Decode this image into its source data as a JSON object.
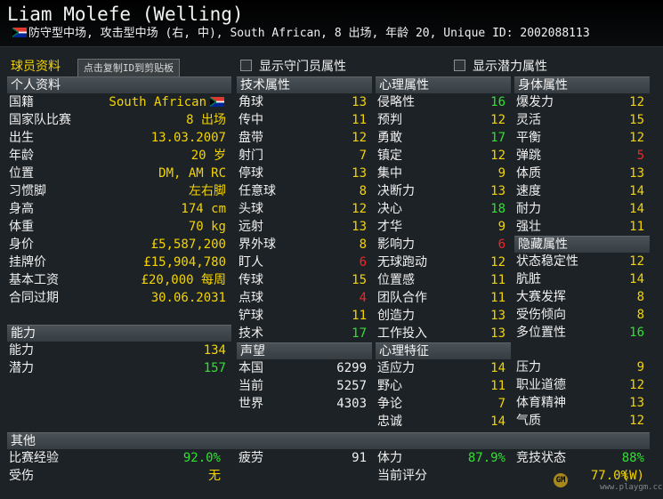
{
  "header": {
    "name": "Liam Molefe (Welling)",
    "subtitle": "防守型中场, 攻击型中场 (右, 中), South African, 8 出场, 年龄 20, Unique ID: 2002088113"
  },
  "toolbar": {
    "tab": "球员资料",
    "copy_tip": "点击复制ID到剪贴板",
    "show_gk": "显示守门员属性",
    "show_potential": "显示潜力属性"
  },
  "personal": {
    "title": "个人资料",
    "rows": [
      {
        "label": "国籍",
        "value": "South African",
        "flag": "south-africa-flag-icon"
      },
      {
        "label": "国家队比赛",
        "value": "8 出场"
      },
      {
        "label": "出生",
        "value": "13.03.2007"
      },
      {
        "label": "年龄",
        "value": "20 岁"
      },
      {
        "label": "位置",
        "value": "DM, AM RC"
      },
      {
        "label": "习惯脚",
        "value": "左右脚"
      },
      {
        "label": "身高",
        "value": "174 cm"
      },
      {
        "label": "体重",
        "value": "70 kg"
      },
      {
        "label": "身价",
        "value": "£5,587,200"
      },
      {
        "label": "挂牌价",
        "value": "£15,904,780"
      },
      {
        "label": "基本工资",
        "value": "£20,000 每周"
      },
      {
        "label": "合同过期",
        "value": "30.06.2031"
      }
    ]
  },
  "technical": {
    "title": "技术属性",
    "rows": [
      {
        "label": "角球",
        "value": "13"
      },
      {
        "label": "传中",
        "value": "11"
      },
      {
        "label": "盘带",
        "value": "12"
      },
      {
        "label": "射门",
        "value": "7"
      },
      {
        "label": "停球",
        "value": "13"
      },
      {
        "label": "任意球",
        "value": "8"
      },
      {
        "label": "头球",
        "value": "12"
      },
      {
        "label": "远射",
        "value": "13"
      },
      {
        "label": "界外球",
        "value": "8"
      },
      {
        "label": "盯人",
        "value": "6"
      },
      {
        "label": "传球",
        "value": "15"
      },
      {
        "label": "点球",
        "value": "4"
      },
      {
        "label": "铲球",
        "value": "11"
      },
      {
        "label": "技术",
        "value": "17"
      }
    ]
  },
  "mental": {
    "title": "心理属性",
    "rows": [
      {
        "label": "侵略性",
        "value": "16"
      },
      {
        "label": "预判",
        "value": "12"
      },
      {
        "label": "勇敢",
        "value": "17"
      },
      {
        "label": "镇定",
        "value": "12"
      },
      {
        "label": "集中",
        "value": "9"
      },
      {
        "label": "决断力",
        "value": "13"
      },
      {
        "label": "决心",
        "value": "18"
      },
      {
        "label": "才华",
        "value": "9"
      },
      {
        "label": "影响力",
        "value": "6"
      },
      {
        "label": "无球跑动",
        "value": "12"
      },
      {
        "label": "位置感",
        "value": "11"
      },
      {
        "label": "团队合作",
        "value": "11"
      },
      {
        "label": "创造力",
        "value": "13"
      },
      {
        "label": "工作投入",
        "value": "13"
      }
    ]
  },
  "physical": {
    "title": "身体属性",
    "rows": [
      {
        "label": "爆发力",
        "value": "12"
      },
      {
        "label": "灵活",
        "value": "15"
      },
      {
        "label": "平衡",
        "value": "12"
      },
      {
        "label": "弹跳",
        "value": "5"
      },
      {
        "label": "体质",
        "value": "13"
      },
      {
        "label": "速度",
        "value": "14"
      },
      {
        "label": "耐力",
        "value": "14"
      },
      {
        "label": "强壮",
        "value": "11"
      }
    ]
  },
  "hidden": {
    "title": "隐藏属性",
    "rows": [
      {
        "label": "状态稳定性",
        "value": "12"
      },
      {
        "label": "肮脏",
        "value": "14"
      },
      {
        "label": "大赛发挥",
        "value": "8"
      },
      {
        "label": "受伤倾向",
        "value": "8"
      },
      {
        "label": "多位置性",
        "value": "16"
      }
    ]
  },
  "ability": {
    "title": "能力",
    "rows": [
      {
        "label": "能力",
        "value": "134"
      },
      {
        "label": "潜力",
        "value": "157"
      }
    ]
  },
  "reputation": {
    "title": "声望",
    "rows": [
      {
        "label": "本国",
        "value": "6299"
      },
      {
        "label": "当前",
        "value": "5257"
      },
      {
        "label": "世界",
        "value": "4303"
      }
    ]
  },
  "traits": {
    "title": "心理特征",
    "rows": [
      {
        "label": "适应力",
        "value": "14"
      },
      {
        "label": "野心",
        "value": "11"
      },
      {
        "label": "争论",
        "value": "7"
      },
      {
        "label": "忠诚",
        "value": "14"
      }
    ]
  },
  "traits2": {
    "rows": [
      {
        "label": "压力",
        "value": "9"
      },
      {
        "label": "职业道德",
        "value": "12"
      },
      {
        "label": "体育精神",
        "value": "13"
      },
      {
        "label": "气质",
        "value": "12"
      }
    ]
  },
  "other": {
    "title": "其他",
    "exp_label": "比赛经验",
    "exp_value": "92.0%",
    "injury_label": "受伤",
    "injury_value": "无",
    "fatigue_label": "疲劳",
    "fatigue_value": "91",
    "rating_label": "当前评分",
    "fitness_label": "体力",
    "fitness_value": "87.9%",
    "form_label": "竞技状态",
    "form_value": "88%",
    "morale_value": "77.0%",
    "morale_tag": "(W)"
  },
  "watermark": {
    "text": "www.playgm.cc"
  },
  "colors": {
    "yellow": "#f4d400",
    "green": "#32e032",
    "red": "#f02828",
    "header_bg": "#4a5257"
  }
}
